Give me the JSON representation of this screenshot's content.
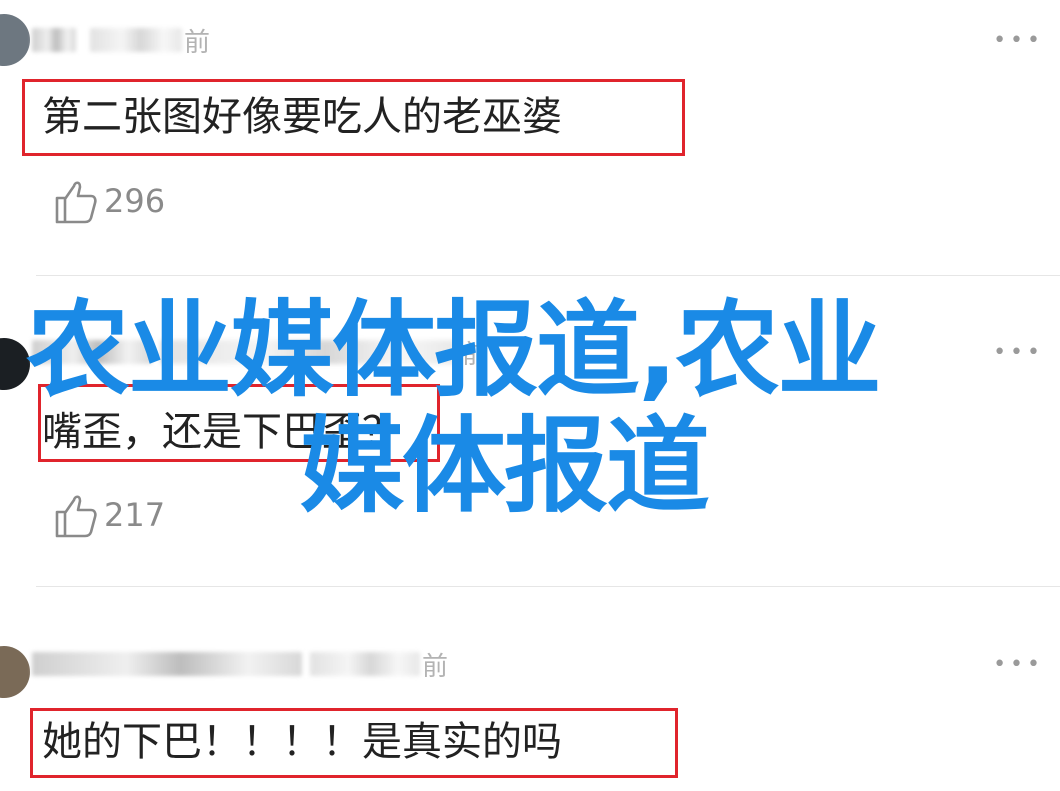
{
  "comments": [
    {
      "time_suffix": "前",
      "text": "第二张图好像要吃人的老巫婆",
      "likes": "296"
    },
    {
      "time_suffix": "前",
      "text": "嘴歪，还是下巴歪？",
      "likes": "217"
    },
    {
      "time_suffix": "前",
      "text": "她的下巴！！！！是真实的吗",
      "likes": ""
    }
  ],
  "more_label": "•••",
  "watermark": {
    "line1": "农业媒体报道,农业",
    "line2": "媒体报道"
  },
  "colors": {
    "highlight_border": "#e0242c",
    "watermark": "#1a8ae6",
    "like_text": "#8a8a8a"
  }
}
